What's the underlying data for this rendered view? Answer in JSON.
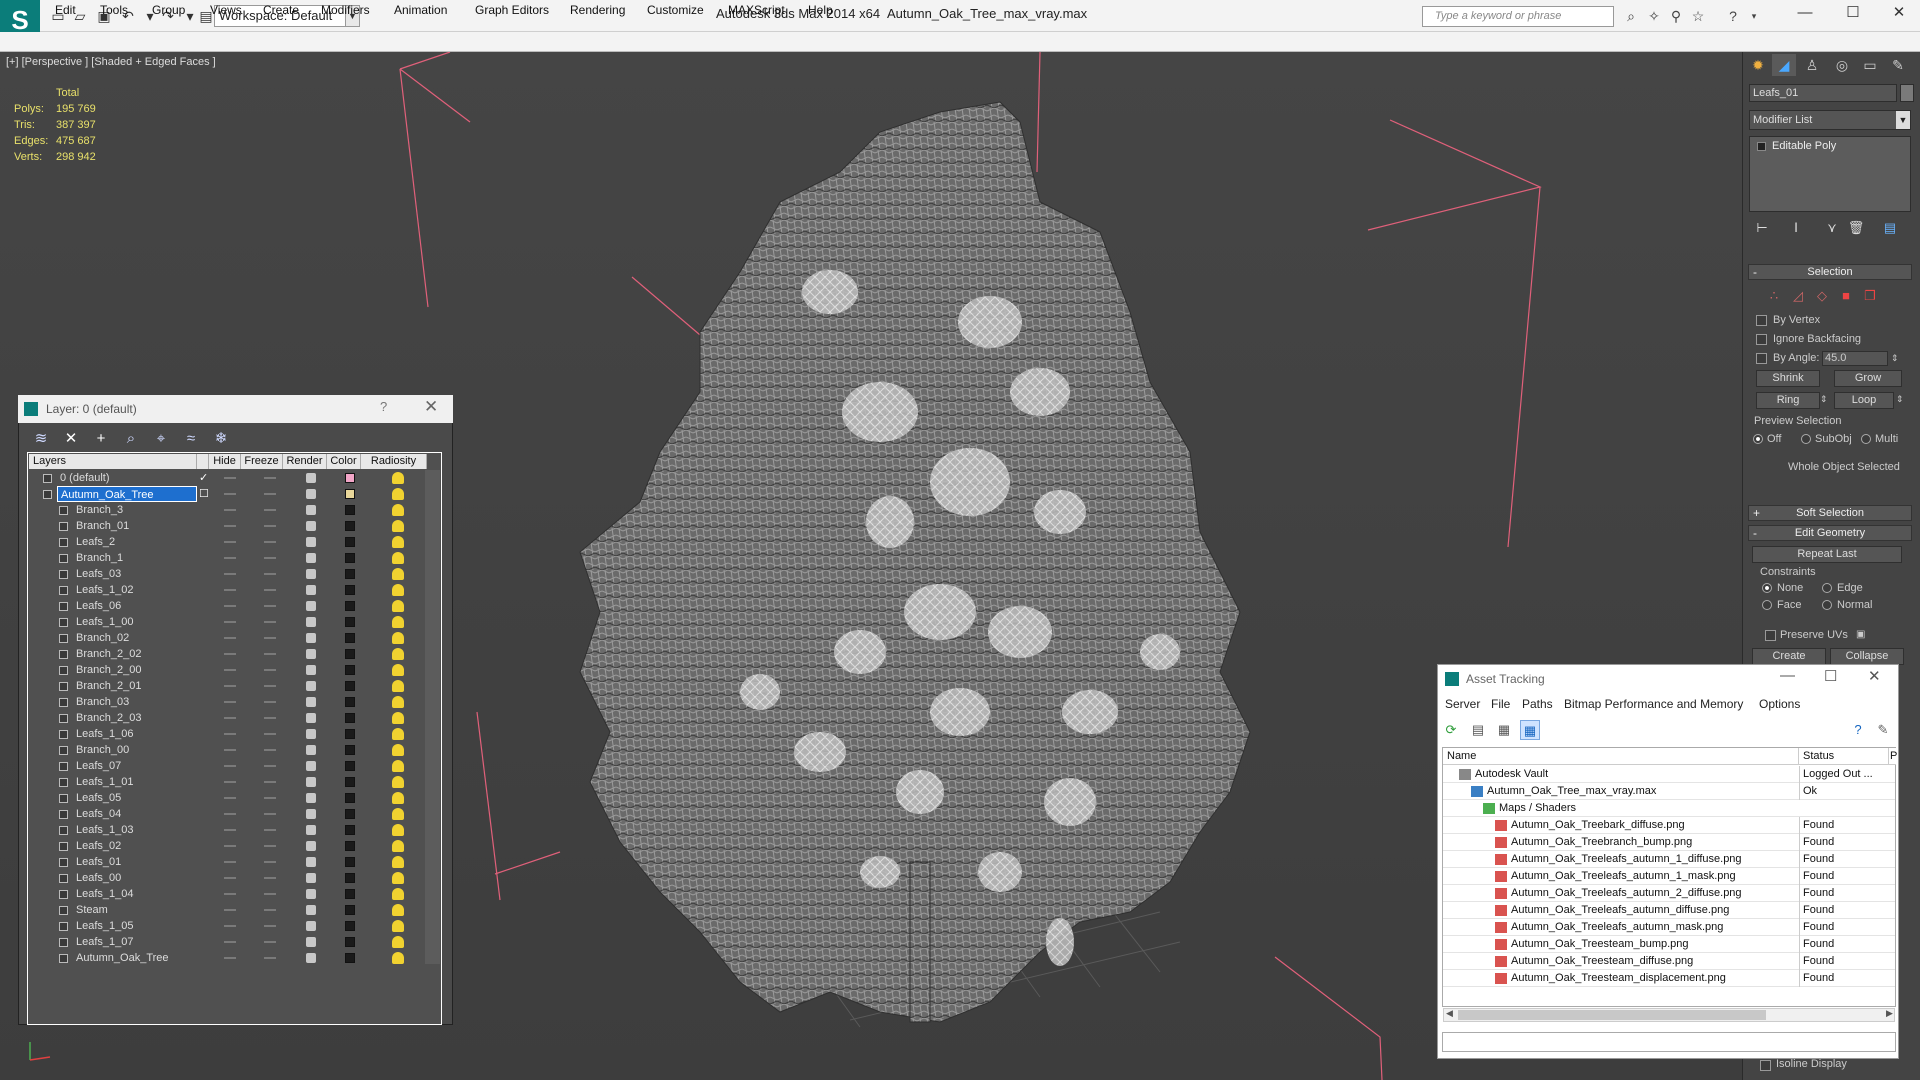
{
  "titlebar": {
    "app_title": "Autodesk 3ds Max  2014 x64",
    "file_title": "Autumn_Oak_Tree_max_vray.max",
    "workspace": "Workspace: Default",
    "search_placeholder": "Type a keyword or phrase"
  },
  "menu": [
    "Edit",
    "Tools",
    "Group",
    "Views",
    "Create",
    "Modifiers",
    "Animation",
    "Graph Editors",
    "Rendering",
    "Customize",
    "MAXScript",
    "Help"
  ],
  "viewport": {
    "label": "[+] [Perspective ] [Shaded + Edged Faces ]",
    "stats_header": "Total",
    "stats": [
      {
        "label": "Polys:",
        "value": "195 769"
      },
      {
        "label": "Tris:",
        "value": "387 397"
      },
      {
        "label": "Edges:",
        "value": "475 687"
      },
      {
        "label": "Verts:",
        "value": "298 942"
      }
    ]
  },
  "command_panel": {
    "object_name": "Leafs_01",
    "modifier_list": "Modifier List",
    "stack_item": "Editable Poly",
    "selection": {
      "title": "Selection",
      "by_vertex": "By Vertex",
      "ignore_backfacing": "Ignore Backfacing",
      "by_angle": "By Angle:",
      "angle_value": "45.0",
      "shrink": "Shrink",
      "grow": "Grow",
      "ring": "Ring",
      "loop": "Loop",
      "preview_selection": "Preview Selection",
      "off": "Off",
      "subobj": "SubObj",
      "multi": "Multi",
      "status": "Whole Object Selected"
    },
    "soft_selection": "Soft Selection",
    "edit_geometry": {
      "title": "Edit Geometry",
      "repeat_last": "Repeat Last",
      "constraints": "Constraints",
      "none": "None",
      "edge": "Edge",
      "face": "Face",
      "normal": "Normal",
      "preserve_uvs": "Preserve UVs",
      "create": "Create",
      "collapse": "Collapse"
    },
    "isoline": "Isoline Display"
  },
  "layer_window": {
    "title": "Layer: 0 (default)",
    "help": "?",
    "columns": [
      "Layers",
      "Hide",
      "Freeze",
      "Render",
      "Color",
      "Radiosity"
    ],
    "rows": [
      {
        "name": "0 (default)",
        "level": 0,
        "color": "#f3a6c8"
      },
      {
        "name": "Autumn_Oak_Tree",
        "level": 0,
        "color": "#e9d79a",
        "selected": true
      },
      {
        "name": "Branch_3",
        "level": 1
      },
      {
        "name": "Branch_01",
        "level": 1
      },
      {
        "name": "Leafs_2",
        "level": 1
      },
      {
        "name": "Branch_1",
        "level": 1
      },
      {
        "name": "Leafs_03",
        "level": 1
      },
      {
        "name": "Leafs_1_02",
        "level": 1
      },
      {
        "name": "Leafs_06",
        "level": 1
      },
      {
        "name": "Leafs_1_00",
        "level": 1
      },
      {
        "name": "Branch_02",
        "level": 1
      },
      {
        "name": "Branch_2_02",
        "level": 1
      },
      {
        "name": "Branch_2_00",
        "level": 1
      },
      {
        "name": "Branch_2_01",
        "level": 1
      },
      {
        "name": "Branch_03",
        "level": 1
      },
      {
        "name": "Branch_2_03",
        "level": 1
      },
      {
        "name": "Leafs_1_06",
        "level": 1
      },
      {
        "name": "Branch_00",
        "level": 1
      },
      {
        "name": "Leafs_07",
        "level": 1
      },
      {
        "name": "Leafs_1_01",
        "level": 1
      },
      {
        "name": "Leafs_05",
        "level": 1
      },
      {
        "name": "Leafs_04",
        "level": 1
      },
      {
        "name": "Leafs_1_03",
        "level": 1
      },
      {
        "name": "Leafs_02",
        "level": 1
      },
      {
        "name": "Leafs_01",
        "level": 1
      },
      {
        "name": "Leafs_00",
        "level": 1
      },
      {
        "name": "Leafs_1_04",
        "level": 1
      },
      {
        "name": "Steam",
        "level": 1
      },
      {
        "name": "Leafs_1_05",
        "level": 1
      },
      {
        "name": "Leafs_1_07",
        "level": 1
      },
      {
        "name": "Autumn_Oak_Tree",
        "level": 1
      }
    ]
  },
  "asset_tracking": {
    "title": "Asset Tracking",
    "menu": [
      "Server",
      "File",
      "Paths",
      "Bitmap Performance and Memory",
      "Options"
    ],
    "columns": [
      "Name",
      "Status",
      "P"
    ],
    "rows": [
      {
        "name": "Autodesk Vault",
        "status": "Logged Out ...",
        "indent": 1,
        "kind": "vault"
      },
      {
        "name": "Autumn_Oak_Tree_max_vray.max",
        "status": "Ok",
        "indent": 2,
        "kind": "max"
      },
      {
        "name": "Maps / Shaders",
        "status": "",
        "indent": 3,
        "kind": "folder"
      },
      {
        "name": "Autumn_Oak_Treebark_diffuse.png",
        "status": "Found",
        "indent": 4,
        "kind": "png"
      },
      {
        "name": "Autumn_Oak_Treebranch_bump.png",
        "status": "Found",
        "indent": 4,
        "kind": "png"
      },
      {
        "name": "Autumn_Oak_Treeleafs_autumn_1_diffuse.png",
        "status": "Found",
        "indent": 4,
        "kind": "png"
      },
      {
        "name": "Autumn_Oak_Treeleafs_autumn_1_mask.png",
        "status": "Found",
        "indent": 4,
        "kind": "png"
      },
      {
        "name": "Autumn_Oak_Treeleafs_autumn_2_diffuse.png",
        "status": "Found",
        "indent": 4,
        "kind": "png"
      },
      {
        "name": "Autumn_Oak_Treeleafs_autumn_diffuse.png",
        "status": "Found",
        "indent": 4,
        "kind": "png"
      },
      {
        "name": "Autumn_Oak_Treeleafs_autumn_mask.png",
        "status": "Found",
        "indent": 4,
        "kind": "png"
      },
      {
        "name": "Autumn_Oak_Treesteam_bump.png",
        "status": "Found",
        "indent": 4,
        "kind": "png"
      },
      {
        "name": "Autumn_Oak_Treesteam_diffuse.png",
        "status": "Found",
        "indent": 4,
        "kind": "png"
      },
      {
        "name": "Autumn_Oak_Treesteam_displacement.png",
        "status": "Found",
        "indent": 4,
        "kind": "png"
      }
    ]
  },
  "colors": {
    "accent_teal": "#0b7d7a",
    "selection_blue": "#1e6fcf",
    "stats_yellow": "#e8e06a",
    "bounding_box": "#e0607a"
  }
}
